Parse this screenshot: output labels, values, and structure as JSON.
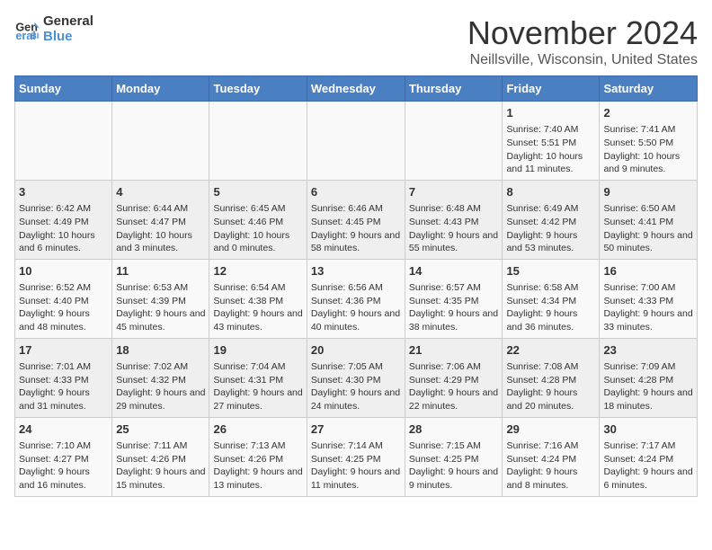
{
  "header": {
    "logo_line1": "General",
    "logo_line2": "Blue",
    "month": "November 2024",
    "location": "Neillsville, Wisconsin, United States"
  },
  "days_of_week": [
    "Sunday",
    "Monday",
    "Tuesday",
    "Wednesday",
    "Thursday",
    "Friday",
    "Saturday"
  ],
  "weeks": [
    [
      {
        "day": "",
        "info": ""
      },
      {
        "day": "",
        "info": ""
      },
      {
        "day": "",
        "info": ""
      },
      {
        "day": "",
        "info": ""
      },
      {
        "day": "",
        "info": ""
      },
      {
        "day": "1",
        "info": "Sunrise: 7:40 AM\nSunset: 5:51 PM\nDaylight: 10 hours and 11 minutes."
      },
      {
        "day": "2",
        "info": "Sunrise: 7:41 AM\nSunset: 5:50 PM\nDaylight: 10 hours and 9 minutes."
      }
    ],
    [
      {
        "day": "3",
        "info": "Sunrise: 6:42 AM\nSunset: 4:49 PM\nDaylight: 10 hours and 6 minutes."
      },
      {
        "day": "4",
        "info": "Sunrise: 6:44 AM\nSunset: 4:47 PM\nDaylight: 10 hours and 3 minutes."
      },
      {
        "day": "5",
        "info": "Sunrise: 6:45 AM\nSunset: 4:46 PM\nDaylight: 10 hours and 0 minutes."
      },
      {
        "day": "6",
        "info": "Sunrise: 6:46 AM\nSunset: 4:45 PM\nDaylight: 9 hours and 58 minutes."
      },
      {
        "day": "7",
        "info": "Sunrise: 6:48 AM\nSunset: 4:43 PM\nDaylight: 9 hours and 55 minutes."
      },
      {
        "day": "8",
        "info": "Sunrise: 6:49 AM\nSunset: 4:42 PM\nDaylight: 9 hours and 53 minutes."
      },
      {
        "day": "9",
        "info": "Sunrise: 6:50 AM\nSunset: 4:41 PM\nDaylight: 9 hours and 50 minutes."
      }
    ],
    [
      {
        "day": "10",
        "info": "Sunrise: 6:52 AM\nSunset: 4:40 PM\nDaylight: 9 hours and 48 minutes."
      },
      {
        "day": "11",
        "info": "Sunrise: 6:53 AM\nSunset: 4:39 PM\nDaylight: 9 hours and 45 minutes."
      },
      {
        "day": "12",
        "info": "Sunrise: 6:54 AM\nSunset: 4:38 PM\nDaylight: 9 hours and 43 minutes."
      },
      {
        "day": "13",
        "info": "Sunrise: 6:56 AM\nSunset: 4:36 PM\nDaylight: 9 hours and 40 minutes."
      },
      {
        "day": "14",
        "info": "Sunrise: 6:57 AM\nSunset: 4:35 PM\nDaylight: 9 hours and 38 minutes."
      },
      {
        "day": "15",
        "info": "Sunrise: 6:58 AM\nSunset: 4:34 PM\nDaylight: 9 hours and 36 minutes."
      },
      {
        "day": "16",
        "info": "Sunrise: 7:00 AM\nSunset: 4:33 PM\nDaylight: 9 hours and 33 minutes."
      }
    ],
    [
      {
        "day": "17",
        "info": "Sunrise: 7:01 AM\nSunset: 4:33 PM\nDaylight: 9 hours and 31 minutes."
      },
      {
        "day": "18",
        "info": "Sunrise: 7:02 AM\nSunset: 4:32 PM\nDaylight: 9 hours and 29 minutes."
      },
      {
        "day": "19",
        "info": "Sunrise: 7:04 AM\nSunset: 4:31 PM\nDaylight: 9 hours and 27 minutes."
      },
      {
        "day": "20",
        "info": "Sunrise: 7:05 AM\nSunset: 4:30 PM\nDaylight: 9 hours and 24 minutes."
      },
      {
        "day": "21",
        "info": "Sunrise: 7:06 AM\nSunset: 4:29 PM\nDaylight: 9 hours and 22 minutes."
      },
      {
        "day": "22",
        "info": "Sunrise: 7:08 AM\nSunset: 4:28 PM\nDaylight: 9 hours and 20 minutes."
      },
      {
        "day": "23",
        "info": "Sunrise: 7:09 AM\nSunset: 4:28 PM\nDaylight: 9 hours and 18 minutes."
      }
    ],
    [
      {
        "day": "24",
        "info": "Sunrise: 7:10 AM\nSunset: 4:27 PM\nDaylight: 9 hours and 16 minutes."
      },
      {
        "day": "25",
        "info": "Sunrise: 7:11 AM\nSunset: 4:26 PM\nDaylight: 9 hours and 15 minutes."
      },
      {
        "day": "26",
        "info": "Sunrise: 7:13 AM\nSunset: 4:26 PM\nDaylight: 9 hours and 13 minutes."
      },
      {
        "day": "27",
        "info": "Sunrise: 7:14 AM\nSunset: 4:25 PM\nDaylight: 9 hours and 11 minutes."
      },
      {
        "day": "28",
        "info": "Sunrise: 7:15 AM\nSunset: 4:25 PM\nDaylight: 9 hours and 9 minutes."
      },
      {
        "day": "29",
        "info": "Sunrise: 7:16 AM\nSunset: 4:24 PM\nDaylight: 9 hours and 8 minutes."
      },
      {
        "day": "30",
        "info": "Sunrise: 7:17 AM\nSunset: 4:24 PM\nDaylight: 9 hours and 6 minutes."
      }
    ]
  ]
}
